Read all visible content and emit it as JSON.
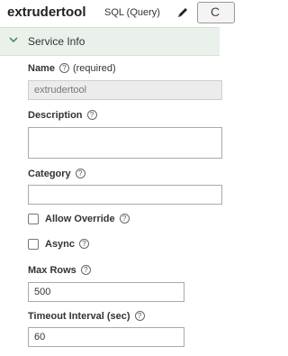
{
  "header": {
    "title": "extrudertool",
    "subtitle": "SQL (Query)",
    "right_button_glyph": "C",
    "edit_icon": "pencil-icon"
  },
  "section": {
    "title": "Service Info",
    "expanded": true,
    "icon": "chevron-down-icon"
  },
  "fields": {
    "name": {
      "label": "Name",
      "required_text": "(required)",
      "value": "extrudertool"
    },
    "description": {
      "label": "Description",
      "value": ""
    },
    "category": {
      "label": "Category",
      "value": ""
    },
    "allow_override": {
      "label": "Allow Override",
      "checked": false
    },
    "async": {
      "label": "Async",
      "checked": false
    },
    "max_rows": {
      "label": "Max Rows",
      "value": "500"
    },
    "timeout": {
      "label": "Timeout Interval (sec)",
      "value": "60"
    }
  },
  "help_icon": "help-icon",
  "colors": {
    "section_bg": "#eaf1ea",
    "readonly_bg": "#ececec",
    "border": "#aaaaaa"
  }
}
